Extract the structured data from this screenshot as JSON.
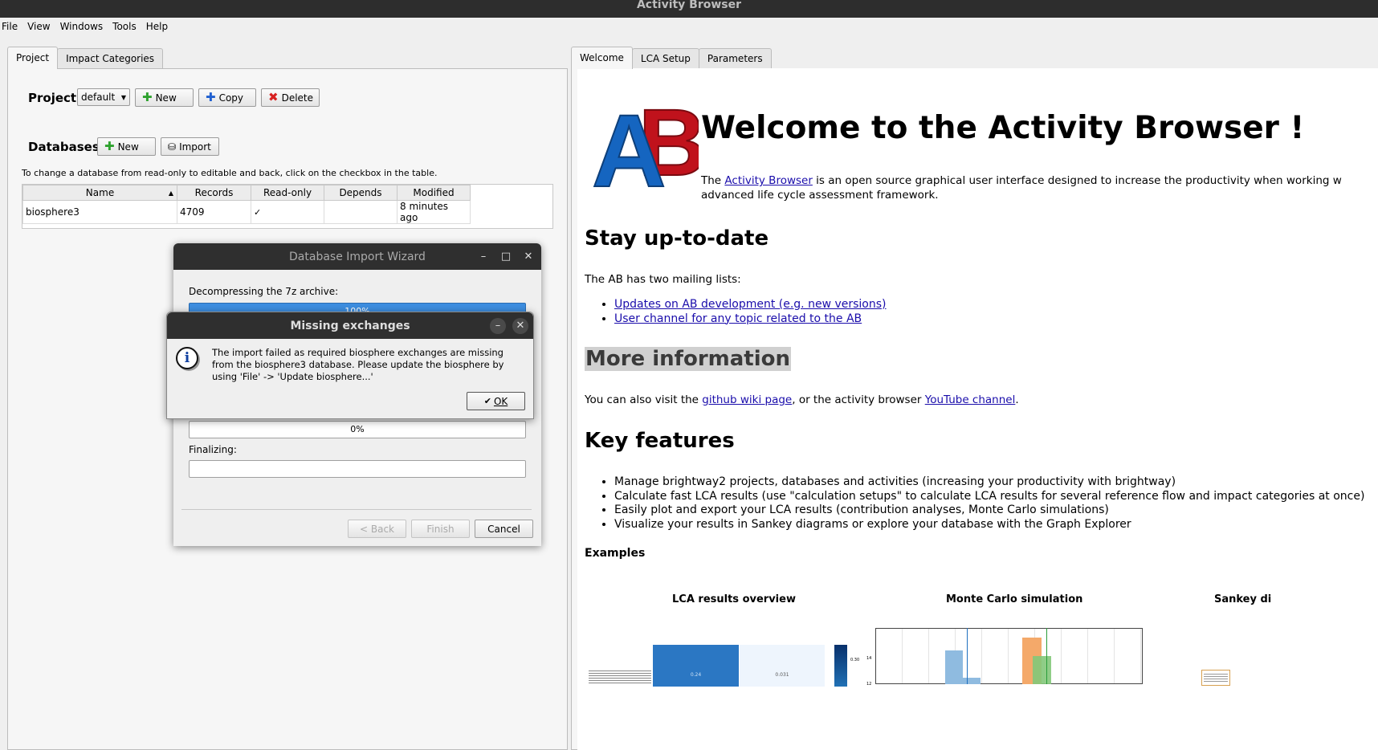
{
  "app": {
    "title": "Activity Browser"
  },
  "menu": [
    "File",
    "View",
    "Windows",
    "Tools",
    "Help"
  ],
  "left_tabs": [
    "Project",
    "Impact Categories"
  ],
  "right_tabs": [
    "Welcome",
    "LCA Setup",
    "Parameters"
  ],
  "project": {
    "label": "Project:",
    "current": "default",
    "new_label": "New",
    "copy_label": "Copy",
    "delete_label": "Delete"
  },
  "databases": {
    "label": "Databases:",
    "new_label": "New",
    "import_label": "Import",
    "hint": "To change a database from read-only to editable and back, click on the checkbox in the table.",
    "columns": [
      "Name",
      "Records",
      "Read-only",
      "Depends",
      "Modified"
    ],
    "rows": [
      {
        "name": "biosphere3",
        "records": "4709",
        "readonly": "✓",
        "depends": "",
        "modified": "8 minutes ago"
      }
    ]
  },
  "wizard": {
    "title": "Database Import Wizard",
    "decompress_label": "Decompressing the 7z archive:",
    "decompress_progress": "100%",
    "progress2": "0%",
    "finalizing_label": "Finalizing:",
    "back_label": "< Back",
    "finish_label": "Finish",
    "cancel_label": "Cancel"
  },
  "msgbox": {
    "title": "Missing exchanges",
    "text": "The import failed as required biosphere exchanges are missing from the biosphere3 database. Please update the biosphere by using 'File' -> 'Update biosphere...'",
    "ok_label": "OK"
  },
  "welcome": {
    "logo": "AB",
    "heading": "Welcome to the Activity Browser !",
    "intro_pre": "The ",
    "intro_link": "Activity Browser",
    "intro_post": " is an open source graphical user interface designed to increase the productivity when working w",
    "intro_post2": "advanced life cycle assessment framework.",
    "stay_heading": "Stay up-to-date",
    "mailing_text": "The AB has two mailing lists:",
    "mailing_links": [
      "Updates on AB development (e.g. new versions)",
      "User channel for any topic related to the AB"
    ],
    "more_heading": "More information",
    "more_pre": "You can also visit the ",
    "more_link1": "github wiki page",
    "more_mid": ", or the activity browser ",
    "more_link2": "YouTube channel",
    "more_post": ".",
    "features_heading": "Key features",
    "features": [
      "Manage brightway2 projects, databases and activities (increasing your productivity with brightway)",
      "Calculate fast LCA results (use \"calculation setups\" to calculate LCA results for several reference flow and impact categories at once)",
      "Easily plot and export your LCA results (contribution analyses, Monte Carlo simulations)",
      "Visualize your results in Sankey diagrams or explore your database with the Graph Explorer"
    ],
    "examples_heading": "Examples",
    "example_titles": [
      "LCA results overview",
      "Monte Carlo simulation",
      "Sankey di"
    ],
    "ex1_values": [
      "0.24",
      "0.031"
    ],
    "ex1_scale": "0.30",
    "ex2_ticks": [
      "14",
      "12"
    ]
  },
  "colors": {
    "logo_blue": "#1565c0",
    "logo_red": "#c0121c",
    "progress_blue": "#3d8ee0"
  }
}
